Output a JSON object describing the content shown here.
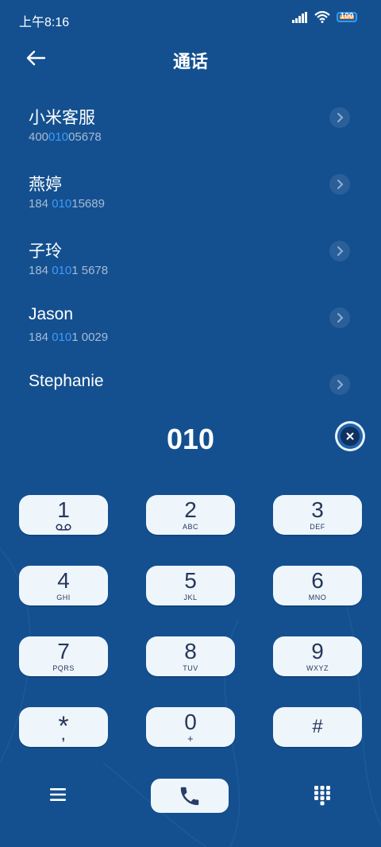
{
  "status_bar": {
    "time": "上午8:16",
    "battery": "100"
  },
  "header": {
    "title": "通话"
  },
  "contacts": [
    {
      "name": "小米客服",
      "num_pre": "400",
      "num_hl": "010",
      "num_post": "05678"
    },
    {
      "name": "燕婷",
      "num_pre": "184 ",
      "num_hl": "010",
      "num_post": "15689"
    },
    {
      "name": "子玲",
      "num_pre": "184 ",
      "num_hl": "010",
      "num_post": "1 5678"
    },
    {
      "name": "Jason",
      "num_pre": "184 ",
      "num_hl": "010",
      "num_post": "1 0029"
    },
    {
      "name": "Stephanie",
      "num_pre": "",
      "num_hl": "",
      "num_post": ""
    }
  ],
  "dialed_number": "010",
  "keypad": [
    {
      "digit": "1",
      "letters": ""
    },
    {
      "digit": "2",
      "letters": "ABC"
    },
    {
      "digit": "3",
      "letters": "DEF"
    },
    {
      "digit": "4",
      "letters": "GHI"
    },
    {
      "digit": "5",
      "letters": "JKL"
    },
    {
      "digit": "6",
      "letters": "MNO"
    },
    {
      "digit": "7",
      "letters": "PQRS"
    },
    {
      "digit": "8",
      "letters": "TUV"
    },
    {
      "digit": "9",
      "letters": "WXYZ"
    },
    {
      "digit": "*",
      "letters": ","
    },
    {
      "digit": "0",
      "letters": "+"
    },
    {
      "digit": "#",
      "letters": ""
    }
  ],
  "icons": {
    "back": "arrow-left-icon",
    "clear": "close-icon",
    "menu": "menu-icon",
    "call": "phone-icon",
    "dialpad": "dialpad-icon",
    "voicemail": "voicemail-icon"
  },
  "colors": {
    "background": "#14508f",
    "highlight": "#3d9bff",
    "key": "#eef6fc"
  }
}
